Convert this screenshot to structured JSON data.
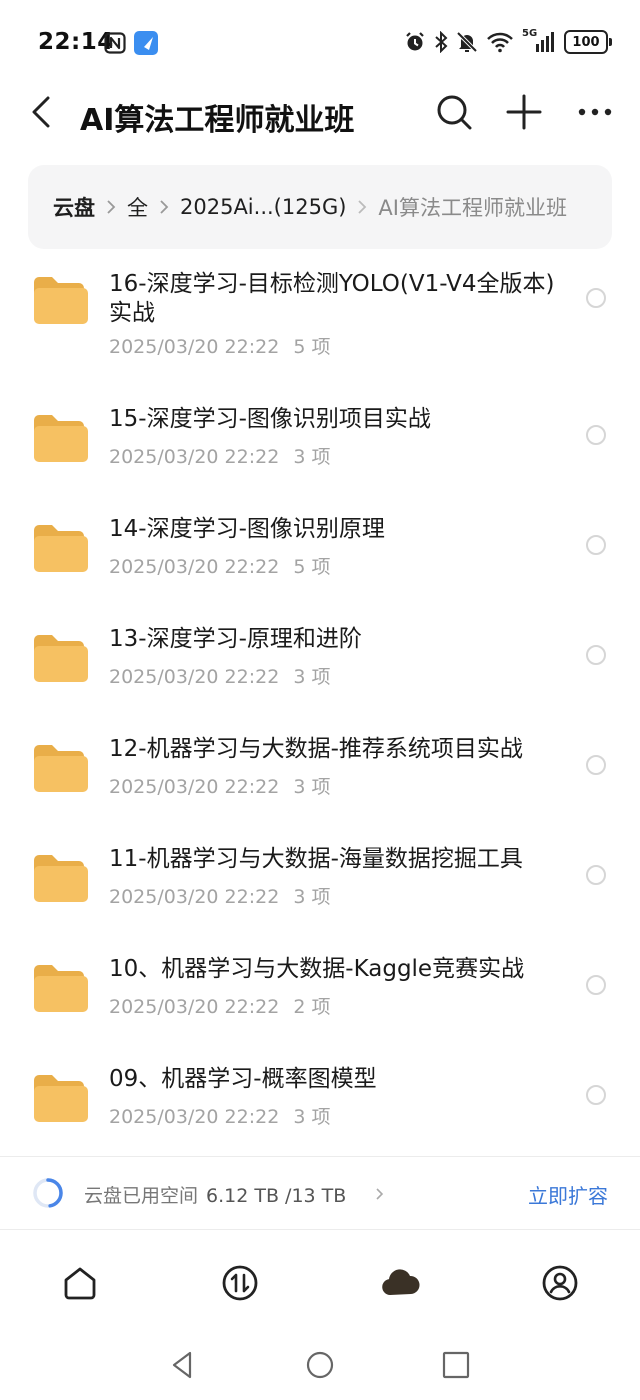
{
  "status_bar": {
    "time": "22:14",
    "network": "5G",
    "battery": "100"
  },
  "header": {
    "title": "AI算法工程师就业班"
  },
  "breadcrumb": {
    "items": [
      "云盘",
      "全",
      "2025Ai...(125G)",
      "AI算法工程师就业班"
    ]
  },
  "files": [
    {
      "name": "16-深度学习-目标检测YOLO(V1-V4全版本)实战",
      "date": "2025/03/20 22:22",
      "count": "5 项"
    },
    {
      "name": "15-深度学习-图像识别项目实战",
      "date": "2025/03/20 22:22",
      "count": "3 项"
    },
    {
      "name": "14-深度学习-图像识别原理",
      "date": "2025/03/20 22:22",
      "count": "5 项"
    },
    {
      "name": "13-深度学习-原理和进阶",
      "date": "2025/03/20 22:22",
      "count": "3 项"
    },
    {
      "name": "12-机器学习与大数据-推荐系统项目实战",
      "date": "2025/03/20 22:22",
      "count": "3 项"
    },
    {
      "name": "11-机器学习与大数据-海量数据挖掘工具",
      "date": "2025/03/20 22:22",
      "count": "3 项"
    },
    {
      "name": "10、机器学习与大数据-Kaggle竞赛实战",
      "date": "2025/03/20 22:22",
      "count": "2 项"
    },
    {
      "name": "09、机器学习-概率图模型",
      "date": "2025/03/20 22:22",
      "count": "3 项"
    }
  ],
  "storage": {
    "label": "云盘已用空间",
    "used": "6.12 TB /13 TB",
    "used_fraction": 0.47,
    "expand_label": "立即扩容"
  },
  "colors": {
    "folder": "#F6C162",
    "link": "#3B78D8",
    "storage_ring": "#4A86E8"
  }
}
